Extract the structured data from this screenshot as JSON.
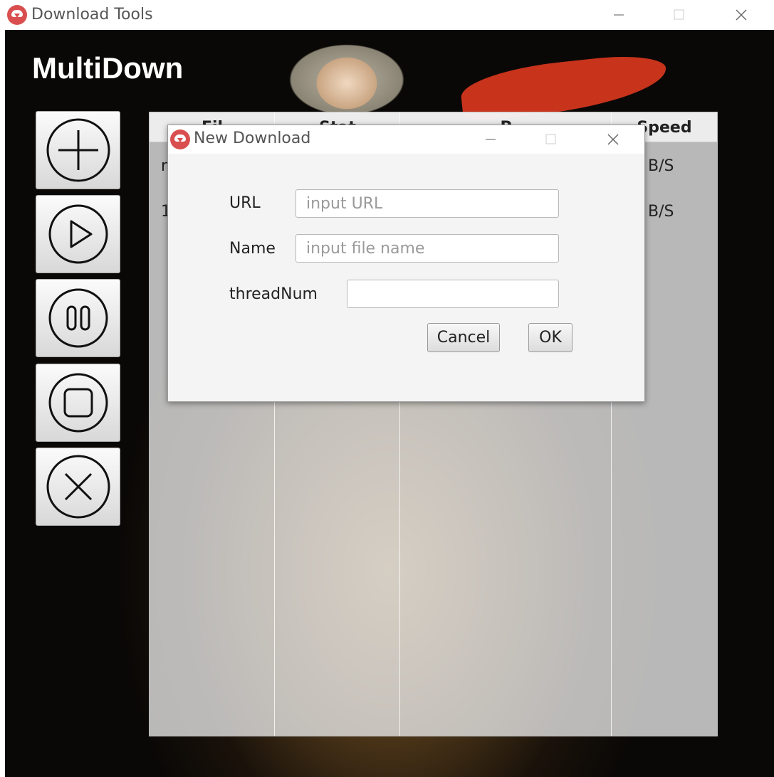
{
  "window": {
    "title": "Download Tools"
  },
  "app": {
    "title": "MultiDown"
  },
  "toolbar": [
    {
      "name": "add-icon"
    },
    {
      "name": "play-icon"
    },
    {
      "name": "pause-icon"
    },
    {
      "name": "stop-icon"
    },
    {
      "name": "close-icon"
    }
  ],
  "table": {
    "headers": [
      "Fil",
      "Stat",
      "P",
      "Speed"
    ],
    "rows": [
      {
        "file": "r",
        "speed": "B/S"
      },
      {
        "file": "1",
        "speed": "B/S"
      }
    ]
  },
  "dialog": {
    "title": "New Download",
    "url_label": "URL",
    "url_placeholder": "input URL",
    "name_label": "Name",
    "name_placeholder": "input file name",
    "thread_label": "threadNum",
    "thread_value": "",
    "cancel_label": "Cancel",
    "ok_label": "OK"
  },
  "colors": {
    "icon_accent": "#d94f4f",
    "scarf": "#c8331c"
  }
}
